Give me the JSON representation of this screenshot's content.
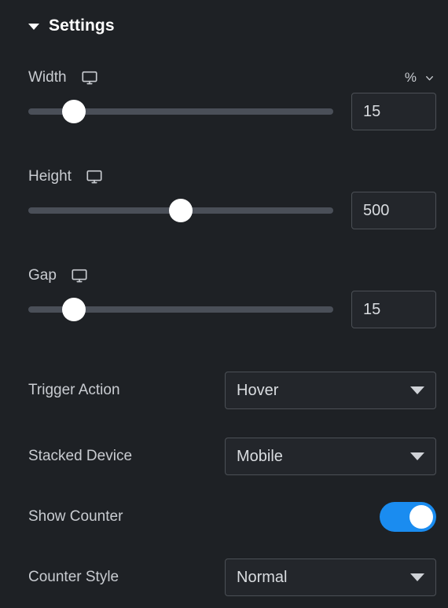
{
  "panel": {
    "header": {
      "title": "Settings",
      "collapse_icon": "caret-down-icon"
    }
  },
  "controls": {
    "width": {
      "label": "Width",
      "device_icon": "desktop-monitor-icon",
      "unit": "%",
      "unit_chevron_icon": "chevron-down-icon",
      "value": "15",
      "slider_percent": 15
    },
    "height": {
      "label": "Height",
      "device_icon": "desktop-monitor-icon",
      "value": "500",
      "slider_percent": 50
    },
    "gap": {
      "label": "Gap",
      "device_icon": "desktop-monitor-icon",
      "value": "15",
      "slider_percent": 15
    },
    "trigger_action": {
      "label": "Trigger Action",
      "value": "Hover",
      "caret_icon": "caret-down-icon"
    },
    "stacked_device": {
      "label": "Stacked Device",
      "value": "Mobile",
      "caret_icon": "caret-down-icon"
    },
    "show_counter": {
      "label": "Show Counter",
      "enabled": true,
      "on_color": "#1a8cf0"
    },
    "counter_style": {
      "label": "Counter Style",
      "value": "Normal",
      "caret_icon": "caret-down-icon"
    }
  },
  "colors": {
    "background": "#1e2125",
    "field_background": "#23262b",
    "field_border": "#4c5056",
    "slider_track": "#4a4f58",
    "slider_thumb": "#ffffff",
    "label_text": "#c9ccd1",
    "accent": "#1a8cf0"
  }
}
